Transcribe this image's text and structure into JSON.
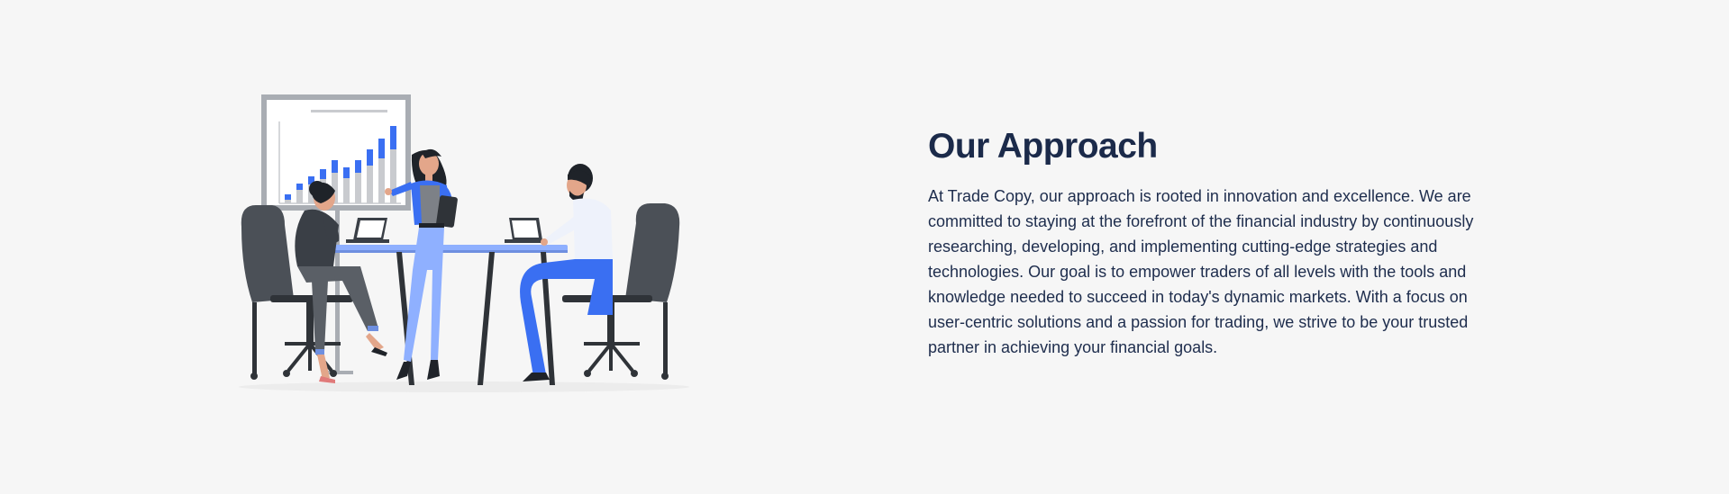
{
  "approach": {
    "title": "Our Approach",
    "body": "At Trade Copy, our approach is rooted in innovation and excellence. We are committed to staying at the forefront of the financial industry by continuously researching, developing, and implementing cutting-edge strategies and technologies. Our goal is to empower traders of all levels with the tools and knowledge needed to succeed in today's dynamic markets. With a focus on user-centric solutions and a passion for trading, we strive to be your trusted partner in achieving your financial goals."
  },
  "illustration": {
    "subject": "team-meeting-illustration",
    "colors": {
      "accent_blue": "#3a6ff2",
      "light_blue": "#8fb0ff",
      "dark_gray": "#4b5057",
      "board_frame": "#a9adb3",
      "bar_gray": "#c9cbcf"
    }
  }
}
